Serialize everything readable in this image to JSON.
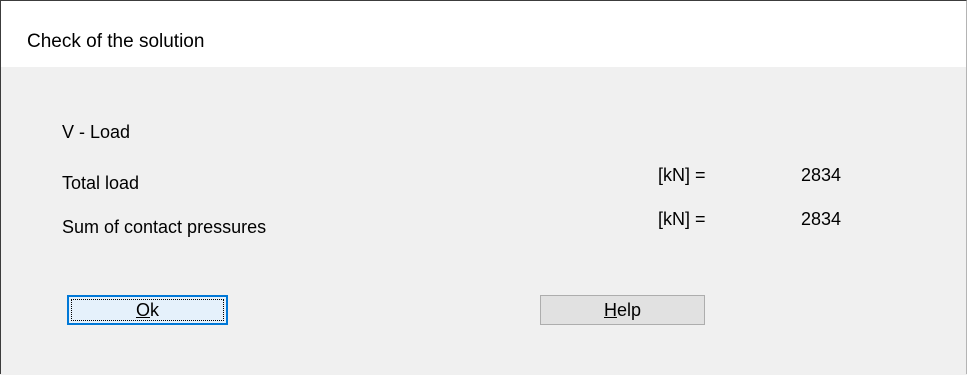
{
  "window": {
    "title": "Check of the solution"
  },
  "content": {
    "section_label": "V - Load",
    "rows": [
      {
        "label": "Total load",
        "unit": "[kN] =",
        "value": "2834"
      },
      {
        "label": "Sum of contact pressures",
        "unit": "[kN] =",
        "value": "2834"
      }
    ]
  },
  "buttons": {
    "ok": {
      "accel": "O",
      "rest": "k"
    },
    "help": {
      "accel": "H",
      "rest": "elp"
    }
  }
}
